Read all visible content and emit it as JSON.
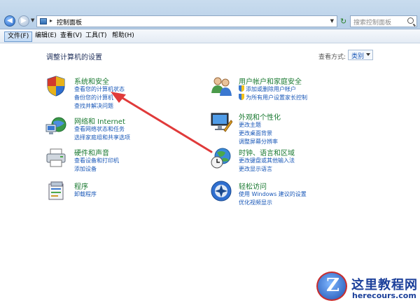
{
  "address_bar": {
    "path": "控制面板",
    "search_placeholder": "搜索控制面板"
  },
  "menu": [
    {
      "label": "文件(F)",
      "active": true
    },
    {
      "label": "编辑(E)",
      "active": false
    },
    {
      "label": "查看(V)",
      "active": false
    },
    {
      "label": "工具(T)",
      "active": false
    },
    {
      "label": "帮助(H)",
      "active": false
    }
  ],
  "page": {
    "title": "调整计算机的设置",
    "view_label": "查看方式:",
    "view_value": "类别"
  },
  "categories_left": [
    {
      "title": "系统和安全",
      "icon": "shield-icon",
      "links": [
        "查看您的计算机状态",
        "备份您的计算机",
        "查找并解决问题"
      ]
    },
    {
      "title": "网络和 Internet",
      "icon": "network-icon",
      "links": [
        "查看网络状态和任务",
        "选择家庭组和共享选项"
      ]
    },
    {
      "title": "硬件和声音",
      "icon": "printer-icon",
      "links": [
        "查看设备和打印机",
        "添加设备"
      ]
    },
    {
      "title": "程序",
      "icon": "programs-icon",
      "links": [
        "卸载程序"
      ]
    }
  ],
  "categories_right": [
    {
      "title": "用户帐户和家庭安全",
      "icon": "users-icon",
      "links": [
        "添加或删除用户帐户",
        "为所有用户设置家长控制"
      ]
    },
    {
      "title": "外观和个性化",
      "icon": "monitor-icon",
      "links": [
        "更改主题",
        "更改桌面背景",
        "调整屏幕分辨率"
      ]
    },
    {
      "title": "时钟、语言和区域",
      "icon": "globe-clock-icon",
      "links": [
        "更改键盘或其他输入法",
        "更改显示语言"
      ]
    },
    {
      "title": "轻松访问",
      "icon": "accessibility-icon",
      "links": [
        "使用 Windows 建议的设置",
        "优化视频显示"
      ]
    }
  ],
  "watermark": {
    "letter": "Z",
    "title": "这里教程网",
    "url": "herecours.com"
  },
  "colors": {
    "link": "#1a58b8",
    "category_title": "#1b7a32",
    "arrow": "#e03a3a"
  }
}
